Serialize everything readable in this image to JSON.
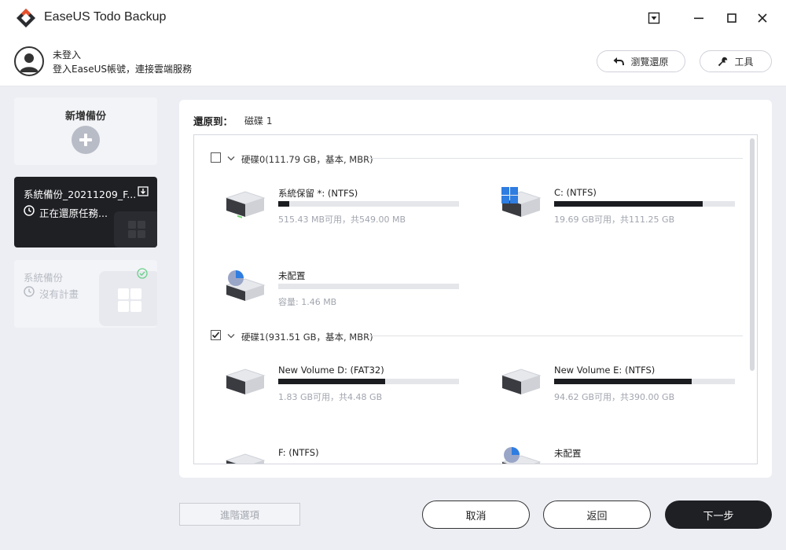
{
  "app": {
    "title": "EaseUS Todo Backup"
  },
  "account": {
    "title": "未登入",
    "subtitle": "登入EaseUS帳號，連接雲端服務"
  },
  "toolbar": {
    "browse_restore_label": "瀏覽還原",
    "tools_label": "工具"
  },
  "sidebar": {
    "new_backup_label": "新增備份",
    "tasks": [
      {
        "name": "系統備份_20211209_F...",
        "status": "正在還原任務..."
      },
      {
        "name": "系統備份",
        "status": "沒有計畫"
      }
    ]
  },
  "restore": {
    "label": "還原到：",
    "target": "磁碟 1"
  },
  "disks": [
    {
      "header": "硬碟0(111.79 GB，基本, MBR)",
      "checked": false,
      "partitions": [
        {
          "name": "系統保留 *: (NTFS)",
          "used_fraction": 0.06,
          "size_text": "515.43 MB可用，共549.00 MB",
          "icon": "drive-icon"
        },
        {
          "name": "C: (NTFS)",
          "used_fraction": 0.82,
          "size_text": "19.69 GB可用，共111.25 GB",
          "icon": "windows-drive-icon"
        },
        {
          "name": "未配置",
          "used_fraction": 0.0,
          "size_text": "容量: 1.46 MB",
          "icon": "unallocated-drive-icon"
        }
      ]
    },
    {
      "header": "硬碟1(931.51 GB，基本, MBR)",
      "checked": true,
      "partitions": [
        {
          "name": "New Volume D: (FAT32)",
          "used_fraction": 0.59,
          "size_text": "1.83 GB可用，共4.48 GB",
          "icon": "drive-icon"
        },
        {
          "name": "New Volume E: (NTFS)",
          "used_fraction": 0.76,
          "size_text": "94.62 GB可用，共390.00 GB",
          "icon": "drive-icon"
        },
        {
          "name": "F: (NTFS)",
          "icon": "drive-icon"
        },
        {
          "name": "未配置",
          "icon": "unallocated-drive-icon"
        }
      ]
    }
  ],
  "footer": {
    "advanced_label": "進階選項",
    "cancel_label": "取消",
    "back_label": "返回",
    "next_label": "下一步"
  },
  "colors": {
    "accent_dark": "#1f2024",
    "windows_blue": "#2f7de1",
    "bar_fill": "#1b1c20"
  }
}
